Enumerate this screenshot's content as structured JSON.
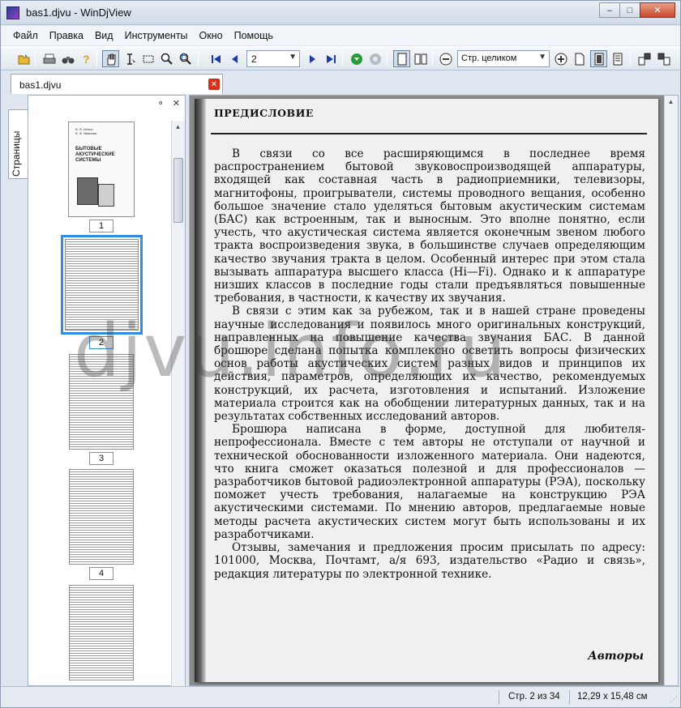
{
  "window": {
    "title": "bas1.djvu - WinDjView"
  },
  "window_buttons": {
    "minimize": "–",
    "maximize": "□",
    "close": "✕"
  },
  "menu": [
    "Файл",
    "Правка",
    "Вид",
    "Инструменты",
    "Окно",
    "Помощь"
  ],
  "toolbar": {
    "page_value": "2",
    "zoom_value": "Стр. целиком"
  },
  "tab": {
    "label": "bas1.djvu",
    "close": "✕"
  },
  "sidebar": {
    "tab_label": "Страницы",
    "pin": "⚬",
    "close": "✕",
    "thumbnails": [
      {
        "label": "1",
        "cover_authors": "В. Я. Ильин\nВ. Ф. Иванова",
        "cover_title": "БЫТОВЫЕ\nАКУСТИЧЕСКИЕ\nСИСТЕМЫ"
      },
      {
        "label": "2",
        "selected": true
      },
      {
        "label": "3"
      },
      {
        "label": "4"
      }
    ]
  },
  "document": {
    "heading": "ПРЕДИСЛОВИЕ",
    "paragraphs": [
      "В связи со все расширяющимся в последнее время распространением бытовой звуковоспроизводящей аппаратуры, входящей как составная часть в радиоприемники, телевизоры, магнитофоны, проигрыватели, системы проводного вещания, особенно большое значение стало уделяться бытовым акустическим системам (БАС) как встроенным, так и выносным. Это вполне понятно, если учесть, что акустическая система является оконечным звеном любого тракта воспроизведения звука, в большинстве случаев определяющим качество звучания тракта в целом. Особенный интерес при этом стала вызывать аппаратура высшего класса (Hi—Fi). Однако и к аппаратуре низших классов в последние годы стали предъявляться повышенные требования, в частности, к качеству их звучания.",
      "В связи с этим как за рубежом, так и в нашей стране проведены научные исследования и появилось много оригинальных конструкций, направленных на повышение качества звучания БАС. В данной брошюре сделана попытка комплексно осветить вопросы физических основ работы акустических систем разных видов и принципов их действия, параметров, определяющих их качество, рекомендуемых конструкций, их расчета, изготовления и испытаний. Изложение материала строится как на обобщении литературных данных, так и на результатах собственных исследований авторов.",
      "Брошюра написана в форме, доступной для любителя-непрофессионала. Вместе с тем авторы не отступали от научной и технической обоснованности изложенного материала. Они надеются, что книга сможет оказаться полезной и для профессионалов — разработчиков бытовой радиоэлектронной аппаратуры (РЭА), поскольку поможет учесть требования, налагаемые на конструкцию РЭА акустическими системами. По мнению авторов, предлагаемые новые методы расчета акустических систем могут быть использованы и их разработчиками.",
      "Отзывы, замечания и предложения просим присылать по адресу: 101000, Москва, Почтамт, а/я 693, издательство «Радио и связь», редакция литературы по электронной технике."
    ],
    "signature": "Авторы",
    "watermark": "djvu.info.ru"
  },
  "status": {
    "page": "Стр. 2 из 34",
    "size": "12,29 x 15,48 см"
  }
}
